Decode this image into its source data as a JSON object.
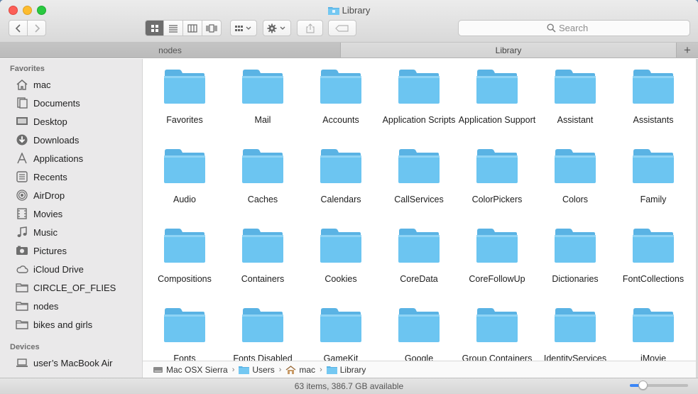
{
  "window": {
    "title": "Library"
  },
  "toolbar": {
    "back_icon": "chevron-left-icon",
    "forward_icon": "chevron-right-icon",
    "view_modes": [
      "icon-view",
      "list-view",
      "column-view",
      "cover-flow-view"
    ],
    "search_placeholder": "Search"
  },
  "tabs": [
    {
      "label": "nodes",
      "active": false
    },
    {
      "label": "Library",
      "active": true
    }
  ],
  "sidebar": {
    "favorites_header": "Favorites",
    "favorites": [
      {
        "label": "mac",
        "icon": "home-icon"
      },
      {
        "label": "Documents",
        "icon": "documents-icon"
      },
      {
        "label": "Desktop",
        "icon": "desktop-icon"
      },
      {
        "label": "Downloads",
        "icon": "downloads-icon"
      },
      {
        "label": "Applications",
        "icon": "applications-icon"
      },
      {
        "label": "Recents",
        "icon": "recents-icon"
      },
      {
        "label": "AirDrop",
        "icon": "airdrop-icon"
      },
      {
        "label": "Movies",
        "icon": "movies-icon"
      },
      {
        "label": "Music",
        "icon": "music-icon"
      },
      {
        "label": "Pictures",
        "icon": "pictures-icon"
      },
      {
        "label": "iCloud Drive",
        "icon": "cloud-icon"
      },
      {
        "label": "CIRCLE_OF_FLIES",
        "icon": "folder-icon"
      },
      {
        "label": "nodes",
        "icon": "folder-icon"
      },
      {
        "label": "bikes and girls",
        "icon": "folder-icon"
      }
    ],
    "devices_header": "Devices",
    "devices": [
      {
        "label": "user’s MacBook Air",
        "icon": "laptop-icon"
      }
    ]
  },
  "folders": [
    "Favorites",
    "Mail",
    "Accounts",
    "Application Scripts",
    "Application Support",
    "Assistant",
    "Assistants",
    "Audio",
    "Caches",
    "Calendars",
    "CallServices",
    "ColorPickers",
    "Colors",
    "Family",
    "Compositions",
    "Containers",
    "Cookies",
    "CoreData",
    "CoreFollowUp",
    "Dictionaries",
    "FontCollections",
    "Fonts",
    "Fonts Disabled",
    "GameKit",
    "Google",
    "Group Containers",
    "IdentityServices",
    "iMovie"
  ],
  "pathbar": [
    {
      "label": "Mac OSX Sierra",
      "icon": "disk-icon"
    },
    {
      "label": "Users",
      "icon": "folder-icon"
    },
    {
      "label": "mac",
      "icon": "home-icon"
    },
    {
      "label": "Library",
      "icon": "folder-icon"
    }
  ],
  "status": {
    "text": "63 items, 386.7 GB available",
    "icon_size_fraction": 0.22
  },
  "colors": {
    "folder": "#6cc5f1",
    "folder_tab": "#5ab3e4",
    "accent": "#3b86f7"
  }
}
